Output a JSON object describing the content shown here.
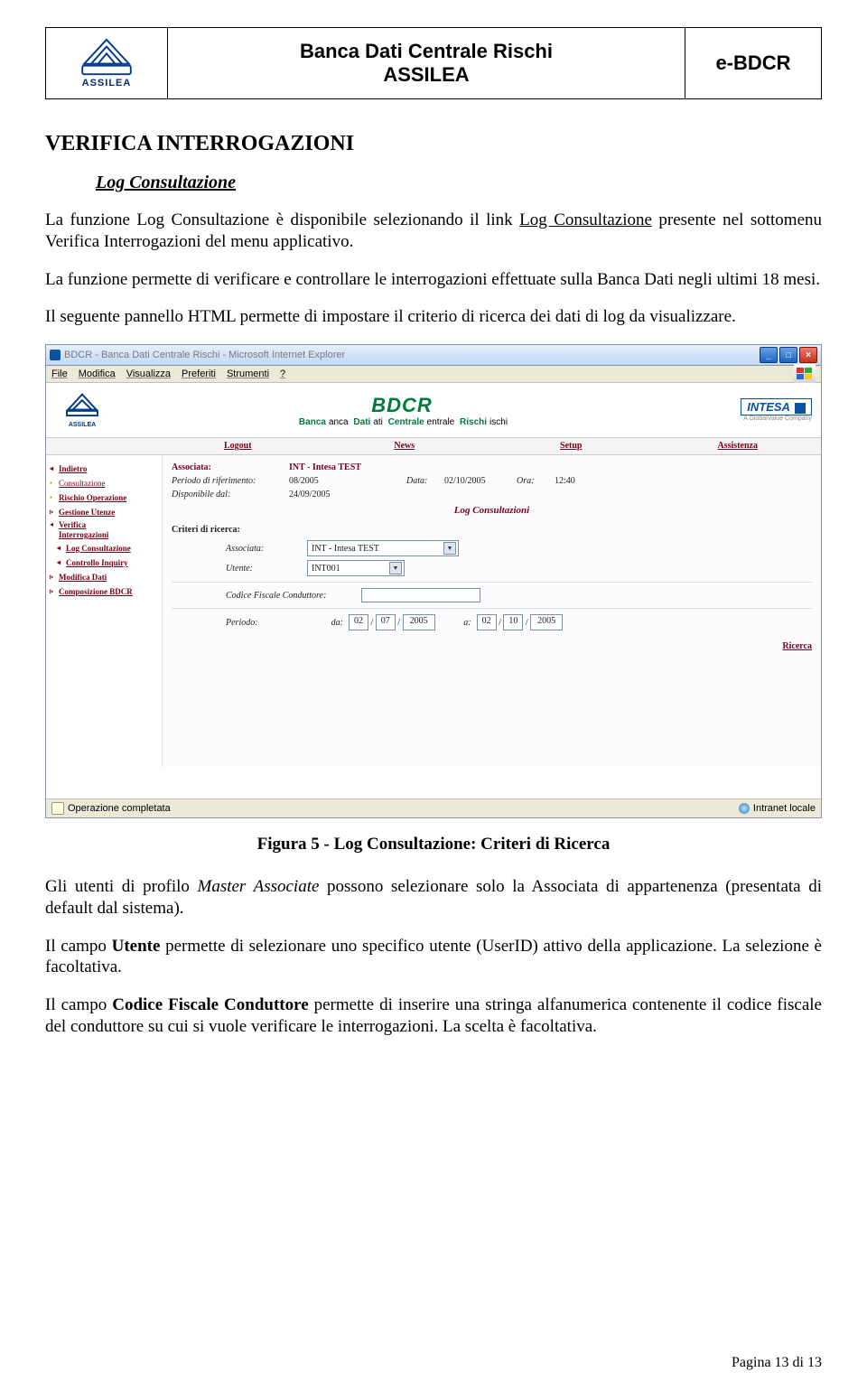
{
  "header": {
    "logo_text": "ASSILEA",
    "title": "Banca Dati Centrale Rischi\nASSILEA",
    "tag": "e-BDCR"
  },
  "doc": {
    "h1": "VERIFICA INTERROGAZIONI",
    "h2": "Log Consultazione",
    "p1_a": "La funzione Log Consultazione è disponibile selezionando il link ",
    "p1_b": "Log Consultazione",
    "p1_c": " presente nel sottomenu Verifica Interrogazioni del menu applicativo.",
    "p2": "La funzione permette di verificare e controllare le interrogazioni effettuate sulla Banca Dati negli ultimi 18 mesi.",
    "p3": "Il seguente pannello HTML permette di impostare il criterio di ricerca dei dati di log da visualizzare.",
    "caption": "Figura 5 - Log Consultazione: Criteri di Ricerca",
    "p4_a": "Gli utenti di profilo ",
    "p4_b": "Master Associate",
    "p4_c": " possono selezionare solo la Associata di appartenenza (presentata di default dal sistema).",
    "p5_a": "Il campo ",
    "p5_b": "Utente",
    "p5_c": " permette di selezionare uno specifico utente (UserID) attivo della applicazione. La selezione è facoltativa.",
    "p6_a": "Il campo ",
    "p6_b": "Codice Fiscale Conduttore",
    "p6_c": " permette di inserire una stringa alfanumerica contenente il codice fiscale del conduttore su cui si vuole verificare le interrogazioni. La scelta è facoltativa.",
    "footer": "Pagina 13 di 13"
  },
  "shot": {
    "title": "BDCR - Banca Dati Centrale Rischi - Microsoft Internet Explorer",
    "menu": {
      "m1": "File",
      "m2": "Modifica",
      "m3": "Visualizza",
      "m4": "Preferiti",
      "m5": "Strumenti",
      "m6": "?"
    },
    "logo_text": "ASSILEA",
    "bdcr": "BDCR",
    "bd_sub_b": "Banca",
    "bd_sub_d": "Dati",
    "bd_sub_c": "Centrale",
    "bd_sub_r": "Rischi",
    "brand": "INTESA",
    "brand_sub": "A GlobalValue Company",
    "nav": {
      "n1": "Logout",
      "n2": "News",
      "n3": "Setup",
      "n4": "Assistenza"
    },
    "side": {
      "s0": "Indietro",
      "s1": "Consultazione",
      "s2": "Rischio Operazione",
      "s3": "Gestione Utenze",
      "s4a": "Verifica",
      "s4b": "Interrogazioni",
      "s5": "Log Consultazione",
      "s6": "Controllo Inquiry",
      "s7": "Modifica Dati",
      "s8": "Composizione BDCR"
    },
    "panel": {
      "assoc_lbl": "Associata:",
      "assoc_val": "INT - Intesa TEST",
      "per_lbl": "Periodo di riferimento:",
      "per_val": "08/2005",
      "data_lbl": "Data:",
      "data_val": "02/10/2005",
      "ora_lbl": "Ora:",
      "ora_val": "12:40",
      "disp_lbl": "Disponibile dal:",
      "disp_val": "24/09/2005",
      "title": "Log Consultazioni",
      "crit": "Criteri di ricerca:",
      "f_assoc_lbl": "Associata:",
      "f_assoc_val": "INT - Intesa TEST",
      "f_ut_lbl": "Utente:",
      "f_ut_val": "INT001",
      "f_cf_lbl": "Codice Fiscale Conduttore:",
      "f_per_lbl": "Periodo:",
      "f_da_lbl": "da:",
      "f_a_lbl": "a:",
      "da_d": "02",
      "da_m": "07",
      "da_y": "2005",
      "a_d": "02",
      "a_m": "10",
      "a_y": "2005",
      "ricerca": "Ricerca"
    },
    "status_left": "Operazione completata",
    "status_right": "Intranet locale"
  }
}
